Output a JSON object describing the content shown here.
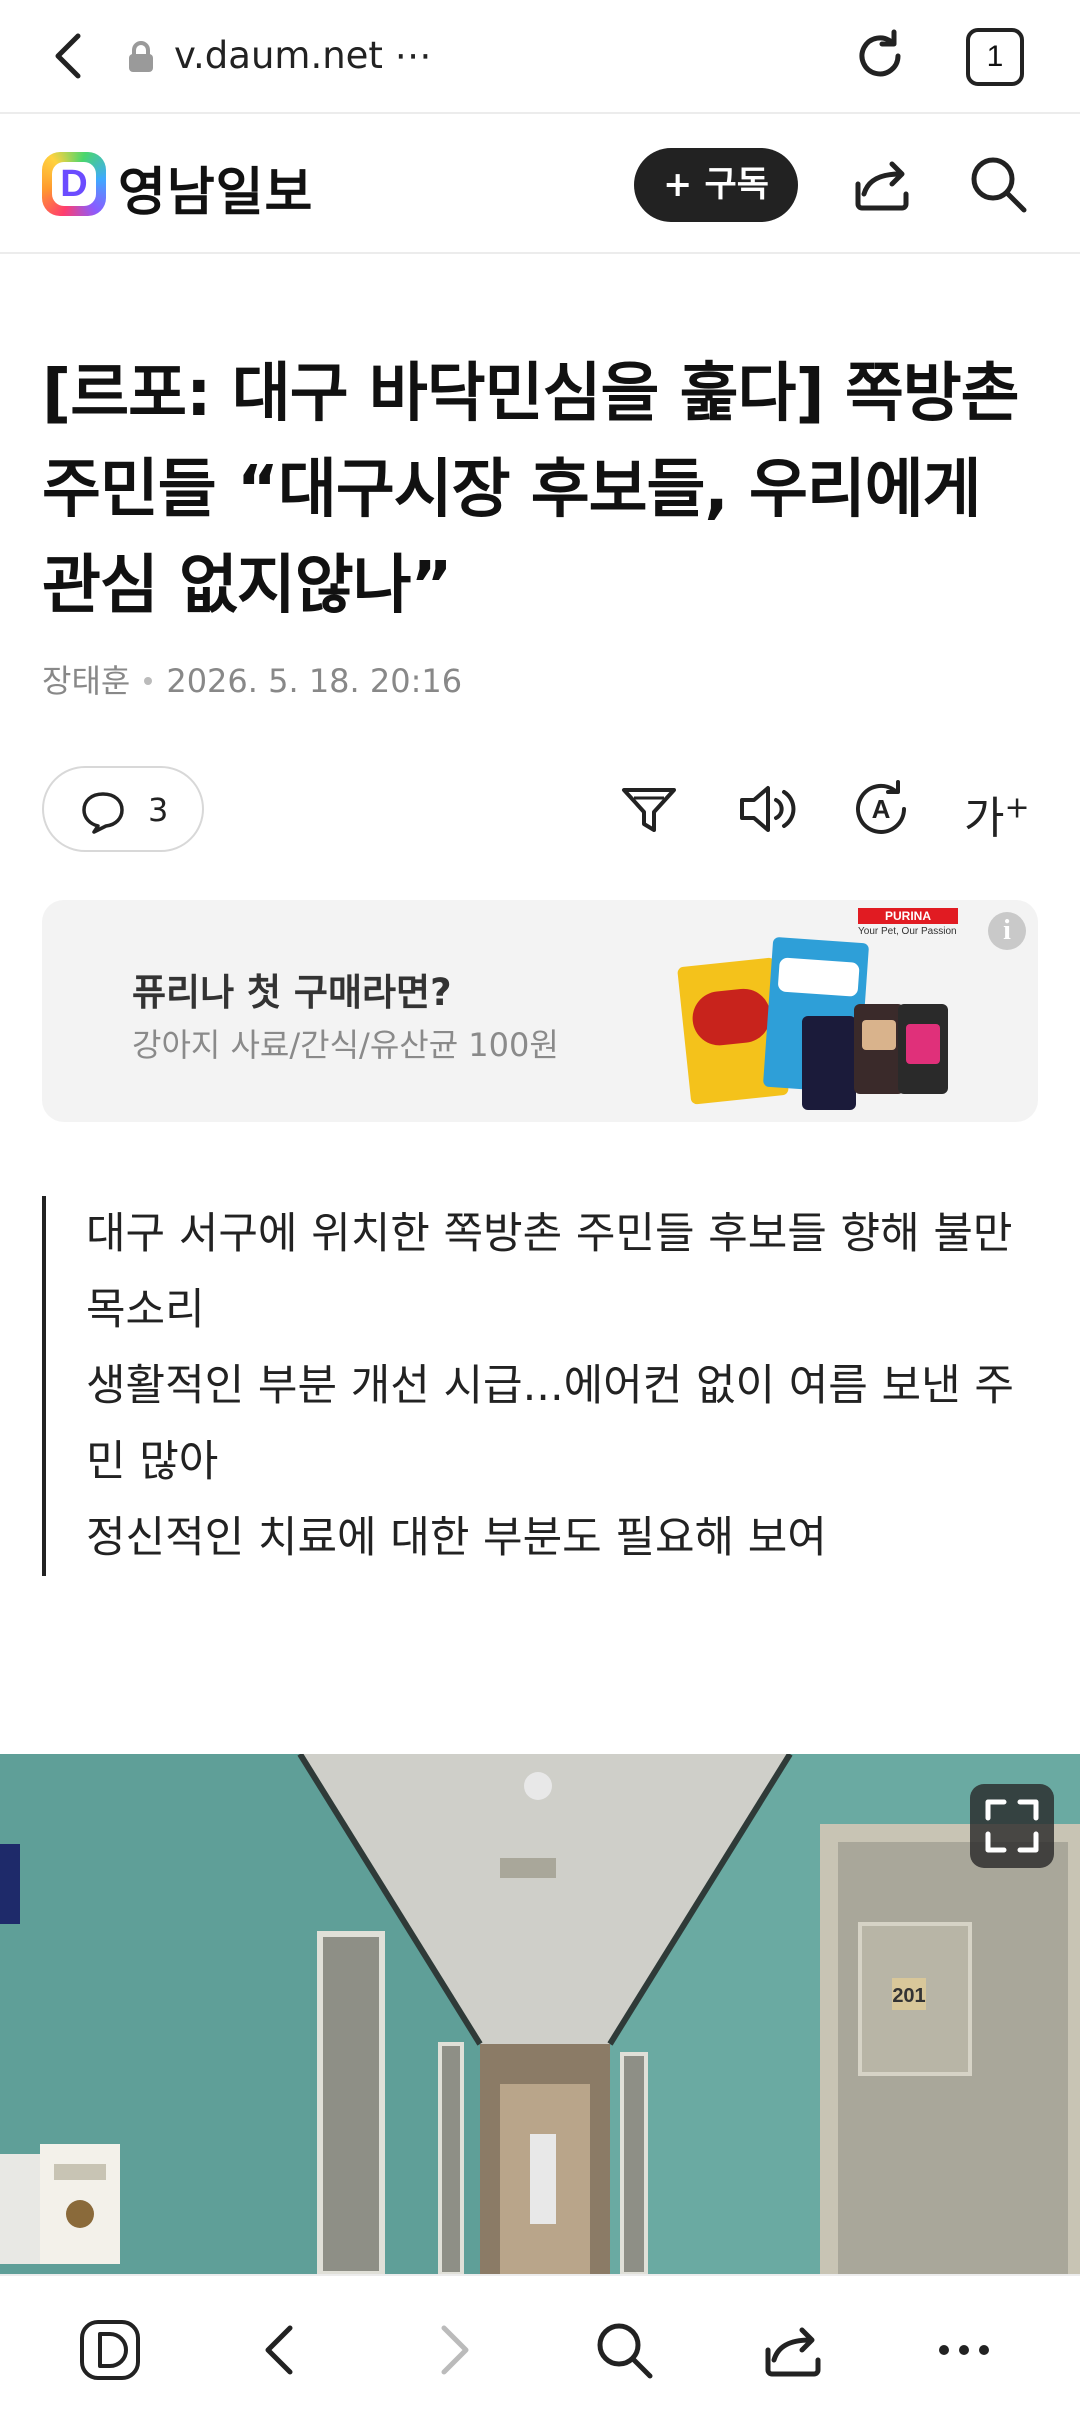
{
  "browser": {
    "url": "v.daum.net ⋯",
    "tab_count": "1"
  },
  "site": {
    "logo_letter": "D",
    "name": "영남일보",
    "subscribe_label": "+ 구독"
  },
  "article": {
    "headline": "[르포: 대구 바닥민심을 훑다] 쪽방촌 주민들 “대구시장 후보들, 우리에게 관심 없지않나”",
    "author": "장태훈",
    "datetime": "2026. 5. 18. 20:16",
    "comment_count": "3",
    "font_size_label": "가",
    "font_size_sup": "+",
    "summary": [
      "대구 서구에 위치한 쪽방촌 주민들 후보들 향해 불만 목소리",
      "생활적인 부분 개선 시급...에어컨 없이 여름 보낸 주민 많아",
      "정신적인 치료에 대한 부분도 필요해 보여"
    ]
  },
  "ad": {
    "title": "퓨리나 첫 구매라면?",
    "subtitle": "강아지 사료/간식/유산균 100원",
    "brand": "PURINA",
    "brand_tagline": "Your Pet, Our Passion",
    "info_icon": "i"
  },
  "photo": {
    "door_number": "201"
  },
  "icons": {
    "back": "chevron-left-icon",
    "lock": "lock-icon",
    "reload": "reload-icon",
    "share": "share-icon",
    "search": "search-icon",
    "comment": "comment-icon",
    "filter": "summary-icon",
    "speaker": "read-aloud-icon",
    "translate": "translate-icon",
    "expand": "expand-icon",
    "more": "more-icon"
  },
  "colors": {
    "subscribe_bg": "#222222",
    "ad_bg": "#f3f3f3",
    "photo_wall": "#6fa9a4"
  }
}
